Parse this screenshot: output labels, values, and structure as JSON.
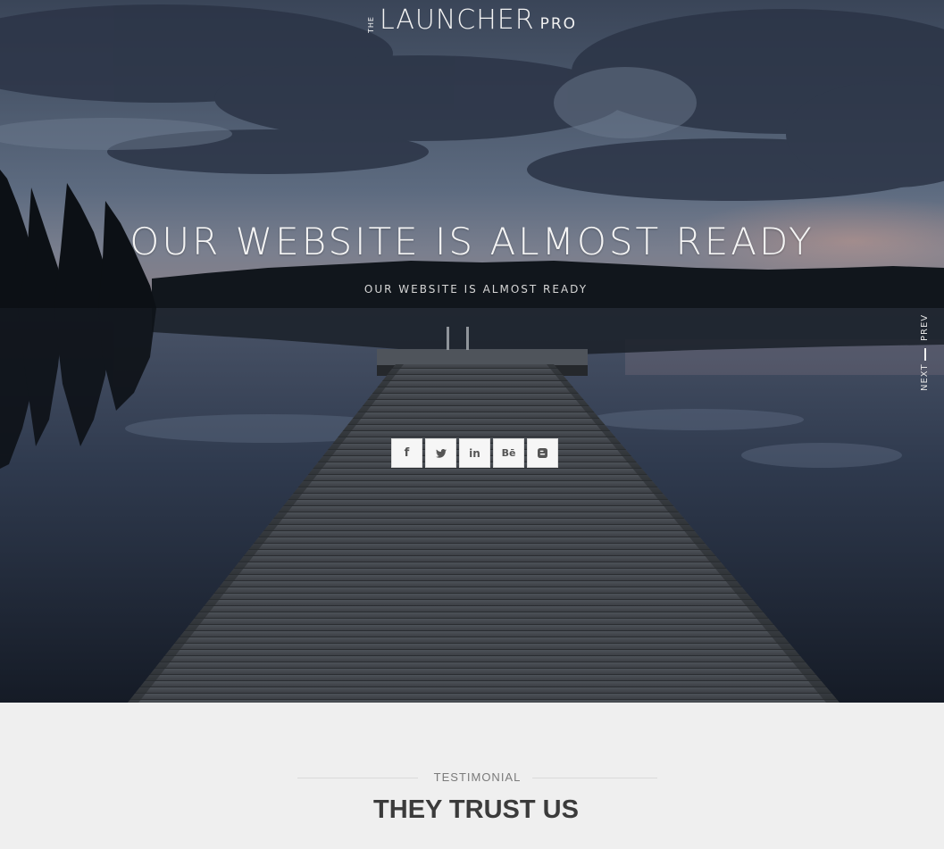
{
  "logo": {
    "small": "THE",
    "main": "LAUNCHER",
    "suffix": "PRO"
  },
  "hero": {
    "headline": "OUR WEBSITE IS ALMOST READY",
    "subheadline": "OUR WEBSITE IS ALMOST READY"
  },
  "slide_nav": {
    "prev": "PREV",
    "next": "NEXT"
  },
  "social": [
    {
      "icon": "facebook-icon",
      "glyph": "f"
    },
    {
      "icon": "twitter-icon",
      "glyph": ""
    },
    {
      "icon": "linkedin-icon",
      "glyph": "in"
    },
    {
      "icon": "behance-icon",
      "glyph": "Bē"
    },
    {
      "icon": "blogger-icon",
      "glyph": ""
    }
  ],
  "testimonial": {
    "eyebrow": "TESTIMONIAL",
    "title": "THEY TRUST US"
  },
  "colors": {
    "hero_sky": "#2a3446",
    "testimonial_bg": "#efefef",
    "title_text": "#3b3b3b"
  }
}
